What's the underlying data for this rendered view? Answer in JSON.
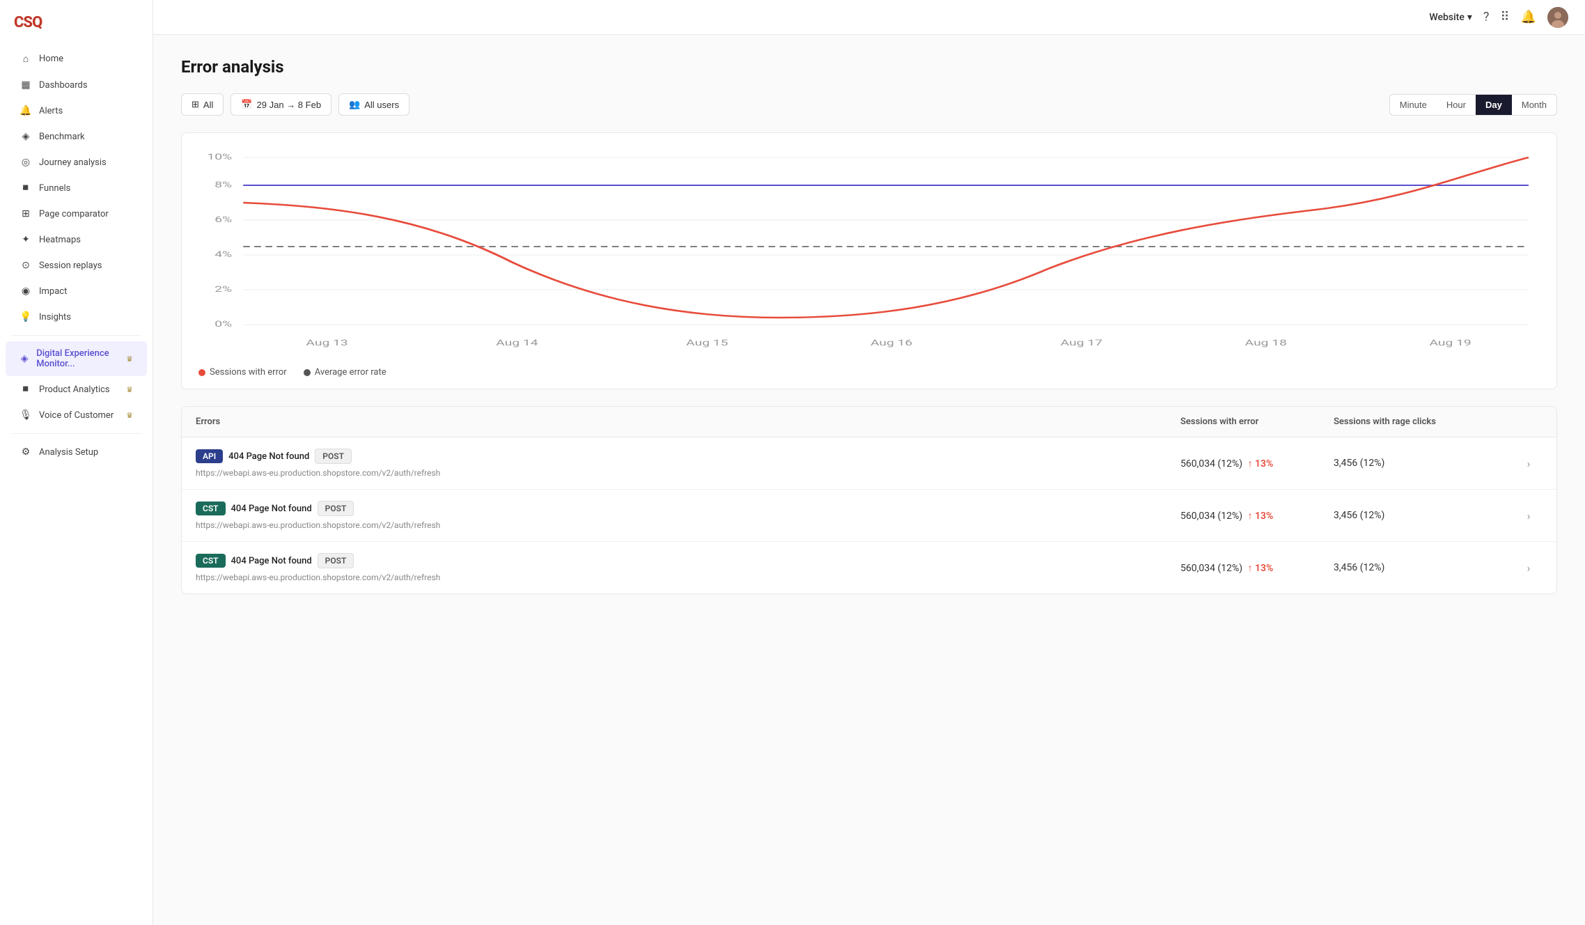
{
  "logo": "CSQ",
  "topbar": {
    "workspace": "Website",
    "chevron": "▾"
  },
  "sidebar": {
    "items": [
      {
        "id": "home",
        "label": "Home",
        "icon": "⌂",
        "active": false
      },
      {
        "id": "dashboards",
        "label": "Dashboards",
        "icon": "▦",
        "active": false
      },
      {
        "id": "alerts",
        "label": "Alerts",
        "icon": "🔔",
        "active": false
      },
      {
        "id": "benchmark",
        "label": "Benchmark",
        "icon": "◈",
        "active": false
      },
      {
        "id": "journey-analysis",
        "label": "Journey analysis",
        "icon": "◎",
        "active": false
      },
      {
        "id": "funnels",
        "label": "Funnels",
        "icon": "📊",
        "active": false
      },
      {
        "id": "page-comparator",
        "label": "Page comparator",
        "icon": "⊞",
        "active": false
      },
      {
        "id": "heatmaps",
        "label": "Heatmaps",
        "icon": "✦",
        "active": false
      },
      {
        "id": "session-replays",
        "label": "Session replays",
        "icon": "⊙",
        "active": false
      },
      {
        "id": "impact",
        "label": "Impact",
        "icon": "◉",
        "active": false
      },
      {
        "id": "insights",
        "label": "Insights",
        "icon": "💡",
        "active": false
      },
      {
        "id": "digital-experience",
        "label": "Digital Experience Monitor...",
        "icon": "◈",
        "active": true,
        "crown": true
      },
      {
        "id": "product-analytics",
        "label": "Product Analytics",
        "icon": "📈",
        "active": false,
        "crown": true
      },
      {
        "id": "voice-of-customer",
        "label": "Voice of Customer",
        "icon": "🎙",
        "active": false,
        "crown": true
      },
      {
        "id": "analysis-setup",
        "label": "Analysis Setup",
        "icon": "⚙",
        "active": false
      }
    ]
  },
  "page": {
    "title": "Error analysis",
    "filters": {
      "all_label": "All",
      "date_label": "29 Jan → 8 Feb",
      "users_label": "All users"
    },
    "time_toggles": [
      "Minute",
      "Hour",
      "Day",
      "Month"
    ],
    "active_toggle": "Day"
  },
  "chart": {
    "y_labels": [
      "10%",
      "8%",
      "6%",
      "4%",
      "2%",
      "0%"
    ],
    "x_labels": [
      "Aug 13",
      "Aug 14",
      "Aug 15",
      "Aug 16",
      "Aug 17",
      "Aug 18",
      "Aug 19"
    ],
    "legend": [
      {
        "label": "Sessions with error",
        "color": "#e74c3c"
      },
      {
        "label": "Average error rate",
        "color": "#555"
      }
    ]
  },
  "table": {
    "headers": [
      "Errors",
      "Sessions with error",
      "Sessions with rage clicks",
      ""
    ],
    "rows": [
      {
        "tag_type": "API",
        "tag_class": "api",
        "error_name": "404 Page Not found",
        "method": "POST",
        "url": "https://webapi.aws-eu.production.shopstore.com/v2/auth/refresh",
        "sessions": "560,034 (12%)",
        "sessions_change": "↑ 13%",
        "rage_clicks": "3,456 (12%)"
      },
      {
        "tag_type": "CST",
        "tag_class": "cst",
        "error_name": "404 Page Not found",
        "method": "POST",
        "url": "https://webapi.aws-eu.production.shopstore.com/v2/auth/refresh",
        "sessions": "560,034 (12%)",
        "sessions_change": "↑ 13%",
        "rage_clicks": "3,456 (12%)"
      },
      {
        "tag_type": "CST",
        "tag_class": "cst",
        "error_name": "404 Page Not found",
        "method": "POST",
        "url": "https://webapi.aws-eu.production.shopstore.com/v2/auth/refresh",
        "sessions": "560,034 (12%)",
        "sessions_change": "↑ 13%",
        "rage_clicks": "3,456 (12%)"
      }
    ]
  }
}
